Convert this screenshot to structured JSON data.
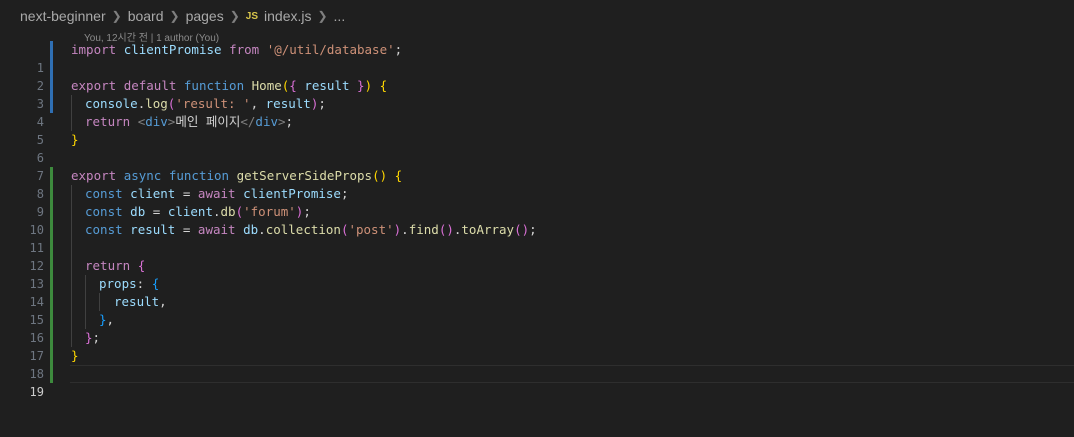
{
  "breadcrumb": {
    "items": [
      "next-beginner",
      "board",
      "pages"
    ],
    "file_badge": "JS",
    "file_name": "index.js",
    "ellipsis": "..."
  },
  "codelens": "You, 12시간 전 | 1 author (You)",
  "code": {
    "line_numbers": [
      "1",
      "2",
      "3",
      "4",
      "5",
      "6",
      "7",
      "8",
      "9",
      "10",
      "11",
      "12",
      "13",
      "14",
      "15",
      "16",
      "17",
      "18",
      "19"
    ],
    "l1": {
      "import": "import",
      "name": "clientPromise",
      "from": "from",
      "path": "'@/util/database'",
      "semi": ";"
    },
    "l3": {
      "export": "export",
      "default": "default",
      "function": "function",
      "name": "Home",
      "open": "(",
      "brace_open": "{",
      "param": "result",
      "brace_close": "}",
      "close": ")",
      "body_open": "{"
    },
    "l4": {
      "obj": "console",
      "dot": ".",
      "method": "log",
      "open": "(",
      "str": "'result: '",
      "comma": ",",
      "arg": "result",
      "close": ")",
      "semi": ";"
    },
    "l5": {
      "return": "return",
      "tag_open": "<",
      "tag": "div",
      "tag_close": ">",
      "text": "메인 페이지",
      "end_tag_open": "</",
      "end_tag": "div",
      "end_tag_close": ">",
      "semi": ";"
    },
    "l6": {
      "close": "}"
    },
    "l8": {
      "export": "export",
      "async": "async",
      "function": "function",
      "name": "getServerSideProps",
      "parens": "()",
      "body_open": "{"
    },
    "l9": {
      "const": "const",
      "name": "client",
      "eq": "=",
      "await": "await",
      "fn": "clientPromise",
      "semi": ";"
    },
    "l10": {
      "const": "const",
      "name": "db",
      "eq": "=",
      "obj": "client",
      "dot": ".",
      "method": "db",
      "open": "(",
      "str": "'forum'",
      "close": ")",
      "semi": ";"
    },
    "l11": {
      "const": "const",
      "name": "result",
      "eq": "=",
      "await": "await",
      "obj": "db",
      "dot1": ".",
      "method1": "collection",
      "open1": "(",
      "str": "'post'",
      "close1": ")",
      "dot2": ".",
      "method2": "find",
      "parens2": "()",
      "dot3": ".",
      "method3": "toArray",
      "parens3": "()",
      "semi": ";"
    },
    "l13": {
      "return": "return",
      "open": "{"
    },
    "l14": {
      "key": "props",
      "colon": ":",
      "open": "{"
    },
    "l15": {
      "val": "result",
      "comma": ","
    },
    "l16": {
      "close": "}",
      "comma": ","
    },
    "l17": {
      "close": "}",
      "semi": ";"
    },
    "l18": {
      "close": "}"
    }
  }
}
